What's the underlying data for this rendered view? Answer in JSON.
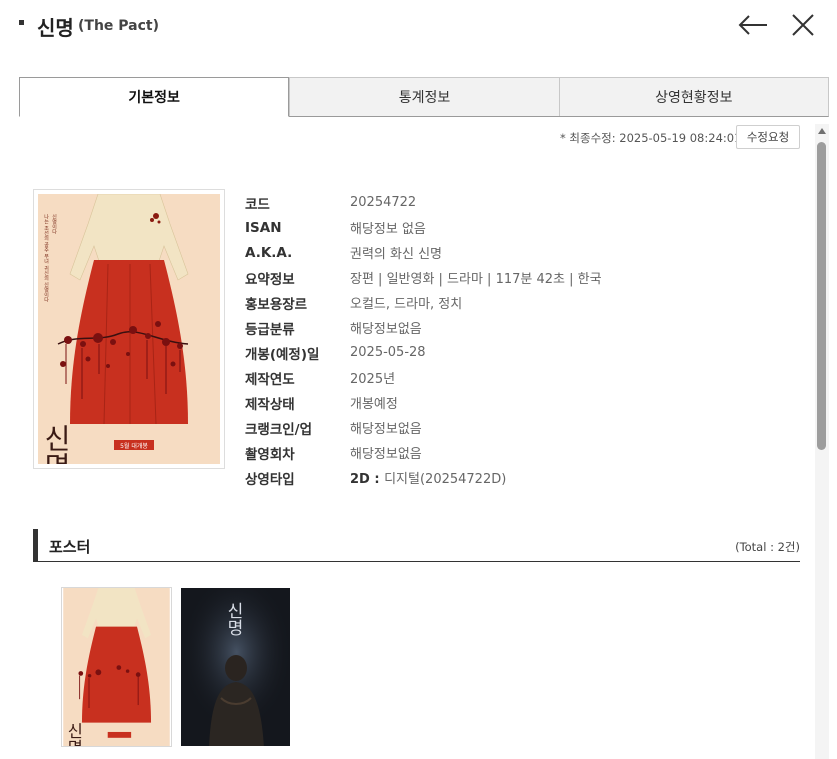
{
  "header": {
    "title": "신명",
    "subtitle": "(The Pact)",
    "back_icon": "arrow-left-icon",
    "close_icon": "close-icon"
  },
  "tabs": [
    {
      "label": "기본정보",
      "active": true
    },
    {
      "label": "통계정보",
      "active": false
    },
    {
      "label": "상영현황정보",
      "active": false
    }
  ],
  "meta": {
    "last_modified": "* 최종수정: 2025-05-19 08:24:01",
    "edit_request_label": "수정요청"
  },
  "poster_text": {
    "title_calligraphy": "신명",
    "release_banner": "5월 대개봉",
    "tagline": "나는 조선의 공주 무녀 귀신의 신명이다",
    "title_calligraphy_2": "신명"
  },
  "info": [
    {
      "label": "코드",
      "value": "20254722"
    },
    {
      "label": "ISAN",
      "value": "해당정보 없음"
    },
    {
      "label": "A.K.A.",
      "value": "권력의 화신 신명"
    },
    {
      "label": "요약정보",
      "value": "장편 | 일반영화 | 드라마 | 117분 42초 | 한국"
    },
    {
      "label": "홍보용장르",
      "value": "오컬드, 드라마, 정치"
    },
    {
      "label": "등급분류",
      "value": "해당정보없음"
    },
    {
      "label": "개봉(예정)일",
      "value": "2025-05-28"
    },
    {
      "label": "제작연도",
      "value": "2025년"
    },
    {
      "label": "제작상태",
      "value": "개봉예정"
    },
    {
      "label": "크랭크인/업",
      "value": "해당정보없음"
    },
    {
      "label": "촬영회차",
      "value": "해당정보없음"
    },
    {
      "label": "상영타입",
      "value_bold": "2D : ",
      "value": "디지털(20254722D)"
    }
  ],
  "poster_section": {
    "title": "포스터",
    "total": "(Total : 2건)"
  },
  "colors": {
    "poster_bg": "#f6dcc2",
    "hanbok_red": "#c8301f",
    "blossom": "#7a1010",
    "dark_poster_bg": "#14171d"
  }
}
